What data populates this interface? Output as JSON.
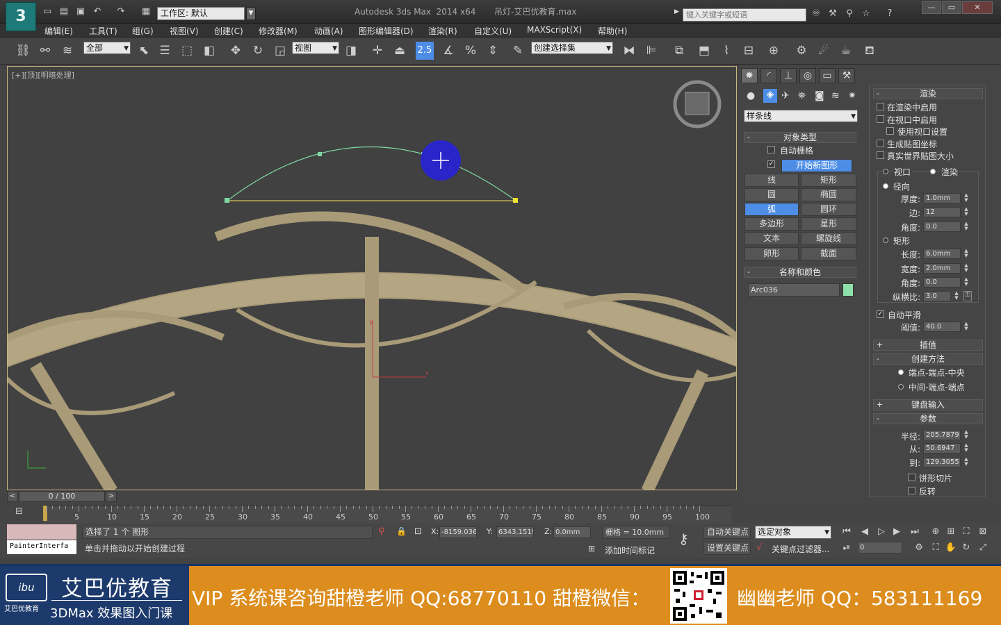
{
  "app": {
    "logo": "3",
    "title": "Autodesk 3ds Max  2014 x64       吊灯-艾巴优教育.max",
    "workspace": "工作区: 默认",
    "search_placeholder": "键入关键字或短语"
  },
  "menus": [
    "编辑(E)",
    "工具(T)",
    "组(G)",
    "视图(V)",
    "创建(C)",
    "修改器(M)",
    "动画(A)",
    "图形编辑器(D)",
    "渲染(R)",
    "自定义(U)",
    "MAXScript(X)",
    "帮助(H)"
  ],
  "toolbar": {
    "filter": "全部",
    "ref_coord": "视图",
    "snap_value": "2.5",
    "selection_set": "创建选择集"
  },
  "viewport": {
    "label": "[+][顶][明暗处理]",
    "colors": {
      "arc": "#7fd9a3",
      "chord": "#e0c45a",
      "model": "#a99a78",
      "cursor_circle": "#2a25c8"
    }
  },
  "command_panel": {
    "category": "样条线",
    "object_type": {
      "header": "对象类型",
      "autogrid": "自动栅格",
      "start_new_shape": "开始新图形",
      "buttons": [
        [
          "线",
          "矩形"
        ],
        [
          "圆",
          "椭圆"
        ],
        [
          "弧",
          "圆环"
        ],
        [
          "多边形",
          "星形"
        ],
        [
          "文本",
          "螺旋线"
        ],
        [
          "卵形",
          "截面"
        ]
      ],
      "active": "弧"
    },
    "name_color": {
      "header": "名称和颜色",
      "name": "Arc036",
      "color": "#8fe0a8"
    }
  },
  "rendering": {
    "header": "渲染",
    "enable_render": "在渲染中启用",
    "enable_viewport": "在视口中启用",
    "use_viewport": "使用视口设置",
    "gen_mapping": "生成贴图坐标",
    "real_world": "真实世界贴图大小",
    "viewport_opt": "视口",
    "render_opt": "渲染",
    "radial": "径向",
    "thickness_lbl": "厚度:",
    "thickness": "1.0mm",
    "sides_lbl": "边:",
    "sides": "12",
    "angle_lbl": "角度:",
    "angle": "0.0",
    "rect": "矩形",
    "length_lbl": "长度:",
    "length": "6.0mm",
    "width_lbl": "宽度:",
    "width": "2.0mm",
    "angle2": "0.0",
    "aspect_lbl": "纵横比:",
    "aspect": "3.0",
    "autosmooth": "自动平滑",
    "threshold_lbl": "阈值:",
    "threshold": "40.0"
  },
  "interpolation": {
    "header": "插值"
  },
  "creation_method": {
    "header": "创建方法",
    "opt1": "端点-端点-中央",
    "opt2": "中间-端点-端点"
  },
  "keyboard": {
    "header": "键盘输入"
  },
  "parameters": {
    "header": "参数",
    "radius_lbl": "半径:",
    "radius": "205.7879",
    "from_lbl": "从:",
    "from": "50.6947",
    "to_lbl": "到:",
    "to": "129.3055",
    "pie": "饼形切片",
    "reverse": "反转"
  },
  "timeline": {
    "frame": "0 / 100",
    "ticks": [
      "5",
      "10",
      "15",
      "20",
      "25",
      "30",
      "35",
      "40",
      "45",
      "50",
      "55",
      "60",
      "65",
      "70",
      "75",
      "80",
      "85",
      "90",
      "95",
      "100"
    ]
  },
  "status": {
    "maxscript": "PainterInterfa",
    "selected": "选择了 1 个 图形",
    "prompt": "单击并拖动以开始创建过程",
    "x": "-8159.036",
    "y": "6343.1519",
    "z": "0.0mm",
    "grid": "栅格 = 10.0mm",
    "add_time_tag": "添加时间标记",
    "auto_key": "自动关键点",
    "set_key": "设置关键点",
    "selected_obj": "选定对象",
    "key_filters": "关键点过滤器...",
    "frame_input": "0"
  },
  "banner": {
    "brand": "艾巴优教育",
    "course": "3DMax 效果图入门课",
    "small": "艾巴优教育",
    "icon": "ibu",
    "promo_left": "VIP 系统课咨询甜橙老师 QQ:68770110   甜橙微信：",
    "promo_right": "幽幽老师 QQ：583111169"
  }
}
